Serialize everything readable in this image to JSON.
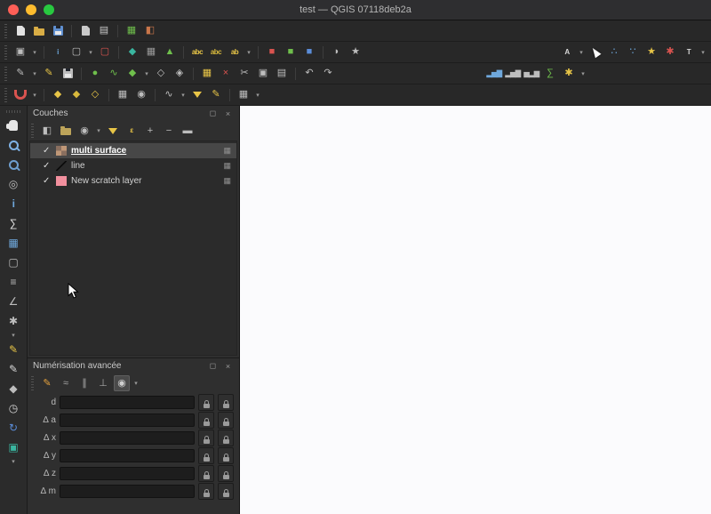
{
  "window": {
    "title": "test — QGIS 07118deb2a"
  },
  "ui": {
    "caret": "▾",
    "check": "✓",
    "delta": "∆",
    "indicator": "▦",
    "float": "◻",
    "close": "×"
  },
  "toolbars": {
    "row1": [
      {
        "t": "grip"
      },
      {
        "n": "new-project",
        "t": "shape",
        "s": "page",
        "c": "#e2e2e2"
      },
      {
        "n": "open-project",
        "t": "shape",
        "s": "folder",
        "c": "#d9ad45"
      },
      {
        "n": "save-project",
        "t": "shape",
        "s": "floppy",
        "c": "#5f8fd0"
      },
      {
        "t": "sep"
      },
      {
        "n": "new-print-layout",
        "t": "shape",
        "s": "page",
        "c": "#c9c9c9"
      },
      {
        "n": "show-layout-manager",
        "t": "glyph",
        "g": "▤",
        "c": "#c9c9c9"
      },
      {
        "t": "sep"
      },
      {
        "n": "open-data-source-manager",
        "t": "glyph",
        "g": "▦",
        "c": "#6fbf4c"
      },
      {
        "n": "style-manager",
        "t": "glyph",
        "g": "◧",
        "c": "#c9764a"
      }
    ],
    "row2_left": [
      {
        "t": "grip"
      },
      {
        "n": "new-map-view",
        "t": "glyph",
        "g": "▣",
        "c": "#bdbdbd"
      },
      {
        "t": "caret",
        "n": "map-view-menu"
      },
      {
        "t": "sep"
      },
      {
        "n": "identify-features",
        "t": "text",
        "v": "i",
        "c": "#6fa8dc"
      },
      {
        "n": "select-features",
        "t": "glyph",
        "g": "▢",
        "c": "#bdbdbd"
      },
      {
        "t": "caret",
        "n": "select-menu"
      },
      {
        "n": "deselect-features",
        "t": "glyph",
        "g": "▢",
        "c": "#d9534f"
      },
      {
        "t": "sep"
      },
      {
        "n": "add-vector-layer",
        "t": "glyph",
        "g": "◆",
        "c": "#3ab6a0"
      },
      {
        "n": "add-raster-layer",
        "t": "glyph",
        "g": "▦",
        "c": "#9a9a9a"
      },
      {
        "n": "add-mesh-layer",
        "t": "glyph",
        "g": "▲",
        "c": "#6fbf4c"
      },
      {
        "t": "sep"
      },
      {
        "n": "show-labels",
        "t": "text",
        "v": "abc",
        "c": "#e8c547"
      },
      {
        "n": "pin-labels",
        "t": "text",
        "v": "abc",
        "c": "#d8b93c"
      },
      {
        "n": "highlight-labels",
        "t": "text",
        "v": "ab",
        "c": "#e8c547"
      },
      {
        "t": "caret",
        "n": "labels-menu"
      },
      {
        "t": "sep"
      },
      {
        "n": "decoration-scalebar",
        "t": "glyph",
        "g": "■",
        "c": "#d9534f"
      },
      {
        "n": "decoration-north-arrow",
        "t": "glyph",
        "g": "■",
        "c": "#6fbf4c"
      },
      {
        "n": "decoration-grid",
        "t": "glyph",
        "g": "■",
        "c": "#5b8dd9"
      },
      {
        "t": "sep"
      },
      {
        "n": "map-tips",
        "t": "glyph",
        "g": "◗",
        "c": "#bdbdbd"
      },
      {
        "n": "new-bookmark",
        "t": "glyph",
        "g": "★",
        "c": "#bdbdbd"
      }
    ],
    "row2_right": [
      {
        "n": "font-settings",
        "t": "text",
        "v": "A",
        "c": "#d8d8d8"
      },
      {
        "t": "caret",
        "n": "font-menu"
      },
      {
        "n": "select-tool",
        "t": "shape",
        "s": "cursor",
        "c": "#ffffff"
      },
      {
        "n": "processing-model",
        "t": "glyph",
        "g": "∴",
        "c": "#6fa8dc"
      },
      {
        "n": "processing-points",
        "t": "glyph",
        "g": "∵",
        "c": "#6fa8dc"
      },
      {
        "n": "favorites",
        "t": "glyph",
        "g": "★",
        "c": "#e8c547"
      },
      {
        "n": "processing-toolbox",
        "t": "glyph",
        "g": "✱",
        "c": "#d9534f"
      },
      {
        "n": "text-annotation",
        "t": "text",
        "v": "T",
        "c": "#d8d8d8"
      },
      {
        "t": "caret",
        "n": "annotation-menu"
      }
    ],
    "row3_left": [
      {
        "t": "grip"
      },
      {
        "n": "current-edits",
        "t": "glyph",
        "g": "✎",
        "c": "#bdbdbd"
      },
      {
        "t": "caret",
        "n": "edits-menu"
      },
      {
        "n": "toggle-editing",
        "t": "glyph",
        "g": "✎",
        "c": "#e8c547"
      },
      {
        "n": "save-edits",
        "t": "shape",
        "s": "floppy",
        "c": "#bdbdbd"
      },
      {
        "t": "sep"
      },
      {
        "n": "capture-point",
        "t": "glyph",
        "g": "●",
        "c": "#6fbf4c"
      },
      {
        "n": "capture-line",
        "t": "glyph",
        "g": "∿",
        "c": "#6fbf4c"
      },
      {
        "n": "capture-polygon",
        "t": "glyph",
        "g": "◆",
        "c": "#6fbf4c"
      },
      {
        "t": "caret",
        "n": "capture-menu"
      },
      {
        "n": "vertex-tool-all-layers",
        "t": "glyph",
        "g": "◇",
        "c": "#bdbdbd"
      },
      {
        "n": "vertex-tool",
        "t": "glyph",
        "g": "◈",
        "c": "#bdbdbd"
      },
      {
        "t": "sep"
      },
      {
        "n": "multi-edit-attributes",
        "t": "glyph",
        "g": "▦",
        "c": "#e8c547"
      },
      {
        "n": "delete-selected",
        "t": "glyph",
        "g": "×",
        "c": "#d9534f"
      },
      {
        "n": "cut-features",
        "t": "glyph",
        "g": "✂",
        "c": "#bdbdbd"
      },
      {
        "n": "copy-features",
        "t": "glyph",
        "g": "▣",
        "c": "#bdbdbd"
      },
      {
        "n": "paste-features",
        "t": "glyph",
        "g": "▤",
        "c": "#bdbdbd"
      },
      {
        "t": "sep"
      },
      {
        "n": "undo",
        "t": "glyph",
        "g": "↶",
        "c": "#bdbdbd"
      },
      {
        "n": "redo",
        "t": "glyph",
        "g": "↷",
        "c": "#bdbdbd"
      }
    ],
    "row3_right": [
      {
        "n": "statistics-histogram-blue",
        "t": "text",
        "v": "▂▅▇",
        "c": "#6fa8dc"
      },
      {
        "n": "statistics-histogram",
        "t": "text",
        "v": "▂▅▇",
        "c": "#bdbdbd"
      },
      {
        "n": "statistics-distribution",
        "t": "text",
        "v": "▅▂▆",
        "c": "#bdbdbd"
      },
      {
        "n": "sum-features",
        "t": "glyph",
        "g": "∑",
        "c": "#6fbf4c"
      },
      {
        "n": "processing-options",
        "t": "glyph",
        "g": "✱",
        "c": "#e8c547"
      },
      {
        "t": "caret",
        "n": "statistics-menu"
      }
    ],
    "row4": [
      {
        "t": "grip"
      },
      {
        "n": "enable-snapping",
        "t": "shape",
        "s": "magnet",
        "c": "#d9534f"
      },
      {
        "t": "caret",
        "n": "snapping-menu"
      },
      {
        "t": "sep"
      },
      {
        "n": "snap-vertex",
        "t": "glyph",
        "g": "◆",
        "c": "#e8c547"
      },
      {
        "n": "snap-segment",
        "t": "glyph",
        "g": "◆",
        "c": "#d8b93c"
      },
      {
        "n": "snap-intersection",
        "t": "glyph",
        "g": "◇",
        "c": "#e8c547"
      },
      {
        "t": "sep"
      },
      {
        "n": "topological-editing",
        "t": "glyph",
        "g": "▦",
        "c": "#bdbdbd"
      },
      {
        "n": "snapping-on-intersection",
        "t": "glyph",
        "g": "◉",
        "c": "#bdbdbd"
      },
      {
        "t": "sep"
      },
      {
        "n": "enable-tracing",
        "t": "glyph",
        "g": "∿",
        "c": "#bdbdbd"
      },
      {
        "t": "caret",
        "n": "tracing-menu"
      },
      {
        "n": "filter-features",
        "t": "shape",
        "s": "funnel",
        "c": "#e8c547"
      },
      {
        "n": "edit-filtered",
        "t": "glyph",
        "g": "✎",
        "c": "#e8c547"
      },
      {
        "t": "sep"
      },
      {
        "n": "show-statistics-grid",
        "t": "glyph",
        "g": "▦",
        "c": "#bdbdbd"
      },
      {
        "t": "caret",
        "n": "grid-menu"
      }
    ],
    "left": [
      {
        "t": "hgrip"
      },
      {
        "n": "pan-map",
        "t": "shape",
        "s": "hand",
        "c": "#e6e6e6"
      },
      {
        "n": "zoom-in",
        "t": "shape",
        "s": "mag",
        "c": "#7fb2e5"
      },
      {
        "n": "zoom-out",
        "t": "shape",
        "s": "mag",
        "c": "#6f9fcf"
      },
      {
        "n": "zoom-full",
        "t": "glyph",
        "g": "◎",
        "c": "#bdbdbd"
      },
      {
        "n": "identify-features",
        "t": "text",
        "v": "i",
        "c": "#6fa8dc"
      },
      {
        "n": "statistical-summary",
        "t": "glyph",
        "g": "∑",
        "c": "#e3e3e3"
      },
      {
        "n": "attribute-table",
        "t": "glyph",
        "g": "▦",
        "c": "#6fa8dc"
      },
      {
        "n": "select-by-form",
        "t": "glyph",
        "g": "▢",
        "c": "#bdbdbd"
      },
      {
        "n": "field-calculator",
        "t": "glyph",
        "g": "≡",
        "c": "#bdbdbd"
      },
      {
        "n": "measure",
        "t": "glyph",
        "g": "∠",
        "c": "#bdbdbd"
      },
      {
        "n": "options-gear",
        "t": "glyph",
        "g": "✱",
        "c": "#bdbdbd"
      },
      {
        "t": "caret",
        "n": "options-menu"
      },
      {
        "n": "text-annotation",
        "t": "glyph",
        "g": "✎",
        "c": "#e8c547"
      },
      {
        "n": "form-annotation",
        "t": "glyph",
        "g": "✎",
        "c": "#d8d8d8"
      },
      {
        "n": "move-annotation",
        "t": "glyph",
        "g": "◆",
        "c": "#bdbdbd"
      },
      {
        "n": "temporal-controller",
        "t": "glyph",
        "g": "◷",
        "c": "#d8d8d8"
      },
      {
        "n": "refresh-map",
        "t": "glyph",
        "g": "↻",
        "c": "#5b8dd9"
      },
      {
        "n": "overview-panel",
        "t": "glyph",
        "g": "▣",
        "c": "#3ab6a0"
      },
      {
        "t": "caret",
        "n": "more-tools-menu"
      }
    ],
    "layers_toolbar": [
      {
        "t": "grip"
      },
      {
        "n": "open-layer-styling",
        "t": "glyph",
        "g": "◧",
        "c": "#bdbdbd"
      },
      {
        "n": "add-group",
        "t": "shape",
        "s": "folder",
        "c": "#bda45a"
      },
      {
        "n": "manage-map-themes",
        "t": "glyph",
        "g": "◉",
        "c": "#bdbdbd"
      },
      {
        "t": "caret",
        "n": "map-themes-menu"
      },
      {
        "n": "filter-legend",
        "t": "shape",
        "s": "funnel",
        "c": "#e8c547"
      },
      {
        "n": "filter-by-expression",
        "t": "text",
        "v": "ε",
        "c": "#e8c547"
      },
      {
        "n": "expand-all",
        "t": "glyph",
        "g": "+",
        "c": "#bdbdbd"
      },
      {
        "n": "collapse-all",
        "t": "glyph",
        "g": "−",
        "c": "#bdbdbd"
      },
      {
        "n": "remove-layer",
        "t": "glyph",
        "g": "▬",
        "c": "#bdbdbd"
      }
    ],
    "digitizing_toolbar": [
      {
        "t": "grip"
      },
      {
        "n": "enable-advanced-digitizing",
        "t": "glyph",
        "g": "✎",
        "c": "#e8a33d"
      },
      {
        "n": "construction-mode",
        "t": "glyph",
        "g": "≈",
        "c": "#a8a8a8"
      },
      {
        "n": "parallel-constraint",
        "t": "glyph",
        "g": "∥",
        "c": "#a8a8a8"
      },
      {
        "n": "perpendicular-constraint",
        "t": "glyph",
        "g": "⊥",
        "c": "#a8a8a8"
      },
      {
        "n": "snap-to-common-angles",
        "t": "glyph",
        "g": "◉",
        "c": "#cfcfcf",
        "hl": true
      },
      {
        "t": "caret",
        "n": "angles-menu"
      }
    ]
  },
  "layers_panel": {
    "title": "Couches",
    "layers": [
      {
        "name": "multi surface",
        "checked": true,
        "selected": true,
        "swatch": "raster"
      },
      {
        "name": "line",
        "checked": true,
        "selected": false,
        "swatch": "line"
      },
      {
        "name": "New scratch layer",
        "checked": true,
        "selected": false,
        "swatch": "color",
        "color": "#f2909e"
      }
    ]
  },
  "digitizing_panel": {
    "title": "Numérisation avancée",
    "rows": [
      {
        "label": "d",
        "delta": false,
        "value": ""
      },
      {
        "label": "a",
        "delta": true,
        "value": ""
      },
      {
        "label": "x",
        "delta": true,
        "value": ""
      },
      {
        "label": "y",
        "delta": true,
        "value": ""
      },
      {
        "label": "z",
        "delta": true,
        "value": ""
      },
      {
        "label": "m",
        "delta": true,
        "value": ""
      }
    ]
  }
}
